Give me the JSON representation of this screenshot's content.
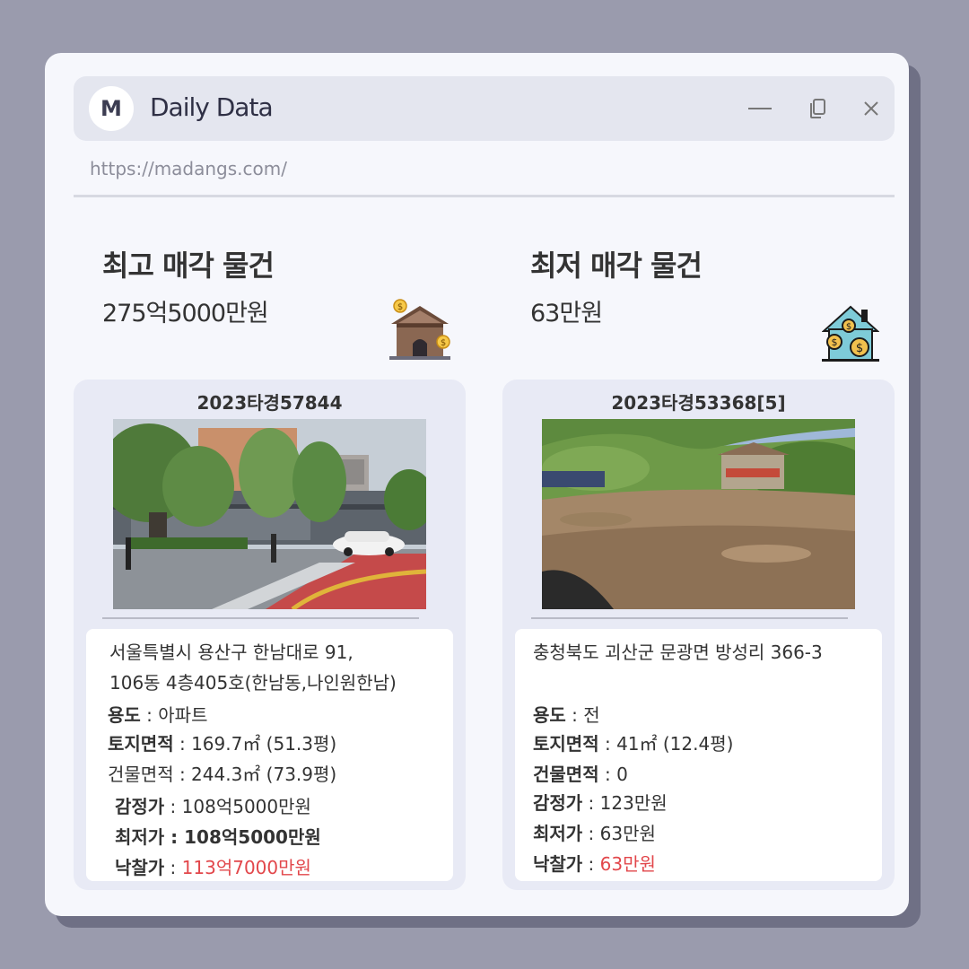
{
  "app": {
    "avatar_letter": "M",
    "title": "Daily Data",
    "url": "https://madangs.com/"
  },
  "highest": {
    "heading": "최고 매각 물건",
    "price": "275억5000만원",
    "icon": "house-money-icon",
    "case_id": "2023타경57844",
    "address_line1": "서울특별시 용산구 한남대로 91,",
    "address_line2": "106동 4층405호(한남동,나인원한남)",
    "usage_label": "용도",
    "usage_value": " : 아파트",
    "land_label": "토지면적",
    "land_value": " : 169.7㎡ (51.3평)",
    "building_label": "건물면적 : 244.3㎡ (73.9평)",
    "appraisal_label": "감정가",
    "appraisal_value": " : 108억5000만원",
    "min_label": "최저가",
    "min_value": " : 108억5000만원",
    "winning_label": "낙찰가",
    "winning_sep": " : ",
    "winning_value": "113억7000만원"
  },
  "lowest": {
    "heading": "최저 매각 물건",
    "price": "63만원",
    "icon": "house-coins-icon",
    "case_id": "2023타경53368[5]",
    "address_line1": "충청북도 괴산군 문광면 방성리 366-3",
    "usage_label": "용도",
    "usage_value": " : 전",
    "land_label": "토지면적",
    "land_value": " : 41㎡ (12.4평)",
    "building_label": "건물면적",
    "building_value": " : 0",
    "appraisal_label": "감정가",
    "appraisal_value": " : 123만원",
    "min_label": "최저가",
    "min_value": " : 63만원",
    "winning_label": "낙찰가",
    "winning_sep": " : ",
    "winning_value": "63만원"
  },
  "colors": {
    "accent_red": "#e2474b",
    "window_bg": "#f6f7fc",
    "card_bg": "#e8eaf5"
  }
}
